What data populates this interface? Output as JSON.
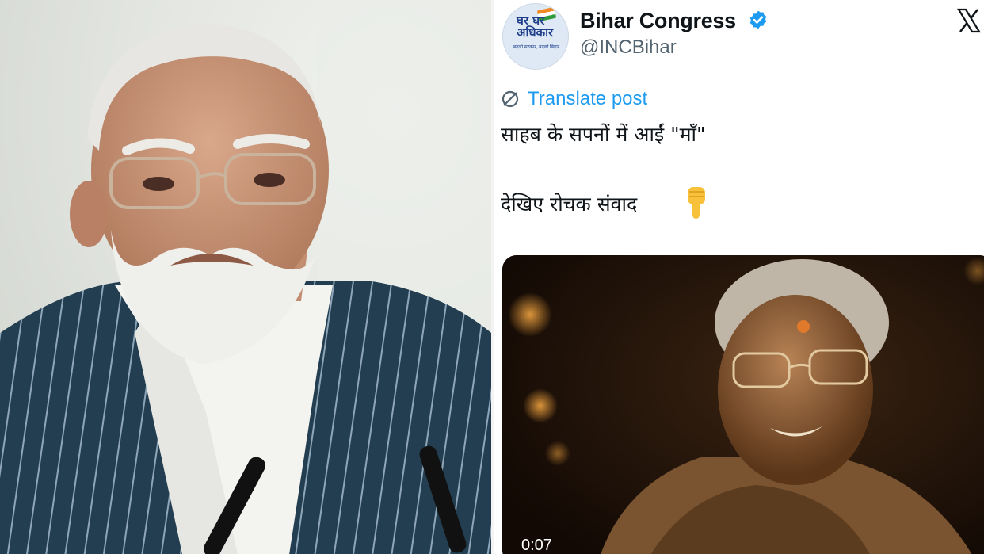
{
  "left_photo": {
    "alt": "photo"
  },
  "tweet": {
    "account_name": "Bihar Congress",
    "handle": "@INCBihar",
    "avatar": {
      "top_text": "घर घर अधिकार",
      "sub_text": "बदलो सरकार, बदलो बिहार"
    },
    "verified": true,
    "platform_icon": "x-logo-icon",
    "translate_label": "Translate post",
    "text_line1": "साहब के सपनों में आईं \"माँ\"",
    "text_line2": "देखिए रोचक संवाद",
    "emoji": "👇",
    "video": {
      "timestamp": "0:07"
    }
  },
  "colors": {
    "accent": "#1d9bf0",
    "text": "#0f1419",
    "muted": "#536471"
  }
}
